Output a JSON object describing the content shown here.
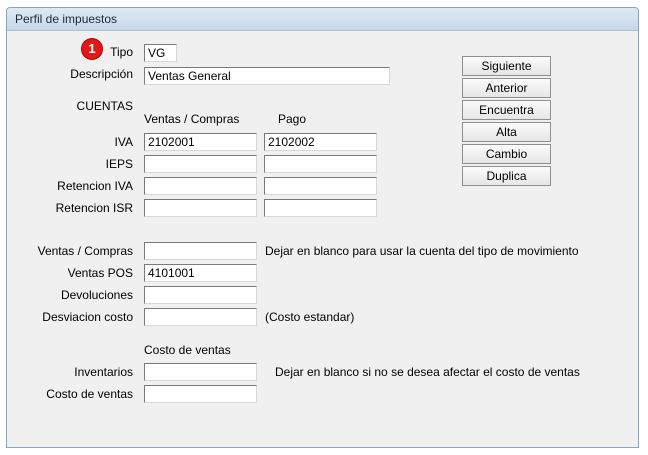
{
  "window": {
    "title": "Perfil de impuestos"
  },
  "step_badge": "1",
  "tipo": {
    "label": "Tipo",
    "value": "VG"
  },
  "descripcion": {
    "label": "Descripción",
    "value": "Ventas General"
  },
  "cuentas": {
    "heading": "CUENTAS",
    "col_ventas_compras": "Ventas / Compras",
    "col_pago": "Pago",
    "rows": [
      {
        "label": "IVA",
        "ventas": "2102001",
        "pago": "2102002"
      },
      {
        "label": "IEPS",
        "ventas": "",
        "pago": ""
      },
      {
        "label": "Retencion IVA",
        "ventas": "",
        "pago": ""
      },
      {
        "label": "Retencion ISR",
        "ventas": "",
        "pago": ""
      }
    ]
  },
  "otros": {
    "ventas_compras": {
      "label": "Ventas / Compras",
      "value": "",
      "note": "Dejar en blanco para usar la cuenta del tipo de movimiento"
    },
    "ventas_pos": {
      "label": "Ventas POS",
      "value": "4101001"
    },
    "devoluciones": {
      "label": "Devoluciones",
      "value": ""
    },
    "desviacion_costo": {
      "label": "Desviacion costo",
      "value": "",
      "note": "(Costo estandar)"
    }
  },
  "costo_ventas": {
    "heading": "Costo de ventas",
    "inventarios": {
      "label": "Inventarios",
      "value": "",
      "note": "Dejar en blanco si no se desea afectar el costo de ventas"
    },
    "costo_de_ventas": {
      "label": "Costo de ventas",
      "value": ""
    }
  },
  "buttons": {
    "siguiente": "Siguiente",
    "anterior": "Anterior",
    "encuentra": "Encuentra",
    "alta": "Alta",
    "cambio": "Cambio",
    "duplica": "Duplica"
  }
}
